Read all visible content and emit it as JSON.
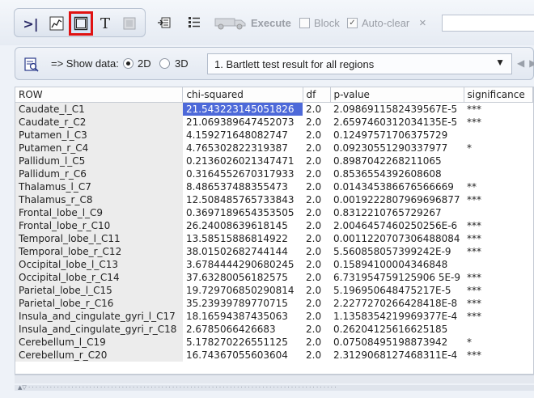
{
  "toolbar": {
    "tools": [
      {
        "name": "script-mode-icon",
        "glyph": "Ɜ"
      },
      {
        "name": "chart-mode-icon",
        "glyph": "📈"
      },
      {
        "name": "table-mode-icon",
        "glyph": ""
      },
      {
        "name": "text-mode-icon",
        "glyph": "T"
      },
      {
        "name": "image-mode-icon",
        "glyph": ""
      }
    ],
    "execute_label": "Execute",
    "block_label": "Block",
    "autoclear_label": "Auto-clear",
    "autoclear_checked": true,
    "close_glyph": "×",
    "search_value": ""
  },
  "options": {
    "show_data_label": "=> Show data:",
    "radio_2d": "2D",
    "radio_3d": "3D",
    "selected_mode": "2D",
    "result_selection": "1. Bartlett test result for all regions"
  },
  "table": {
    "columns": [
      "ROW",
      "chi-squared",
      "df",
      "p-value",
      "significance"
    ],
    "rows": [
      [
        "Caudate_l_C1",
        "21.543223145051826",
        "2.0",
        "2.0986911582439567E-5",
        "***"
      ],
      [
        "Caudate_r_C2",
        "21.069389647452073",
        "2.0",
        "2.6597460312034135E-5",
        "***"
      ],
      [
        "Putamen_l_C3",
        "4.159271648082747",
        "2.0",
        "0.12497571706375729",
        ""
      ],
      [
        "Putamen_r_C4",
        "4.765302822319387",
        "2.0",
        "0.09230551290337977",
        "*"
      ],
      [
        "Pallidum_l_C5",
        "0.2136026021347471",
        "2.0",
        "0.8987042268211065",
        ""
      ],
      [
        "Pallidum_r_C6",
        "0.3164552670317933",
        "2.0",
        "0.8536554392608608",
        ""
      ],
      [
        "Thalamus_l_C7",
        "8.486537488355473",
        "2.0",
        "0.014345386676566669",
        "**"
      ],
      [
        "Thalamus_r_C8",
        "12.508485765733843",
        "2.0",
        "0.0019222807969696877",
        "***"
      ],
      [
        "Frontal_lobe_l_C9",
        "0.3697189654353505",
        "2.0",
        "0.8312210765729267",
        ""
      ],
      [
        "Frontal_lobe_r_C10",
        "26.24008639618145",
        "2.0",
        "2.0046457460250256E-6",
        "***"
      ],
      [
        "Temporal_lobe_l_C11",
        "13.58515886814922",
        "2.0",
        "0.0011220707306488084",
        "***"
      ],
      [
        "Temporal_lobe_r_C12",
        "38.01502682744144",
        "2.0",
        "5.560858057399242E-9",
        "***"
      ],
      [
        "Occipital_lobe_l_C13",
        "3.6784444290680245",
        "2.0",
        "0.15894100004346848",
        ""
      ],
      [
        "Occipital_lobe_r_C14",
        "37.63280056182575",
        "2.0",
        "6.731954759125906 5E-9",
        "***"
      ],
      [
        "Parietal_lobe_l_C15",
        "19.729706850290814",
        "2.0",
        "5.196950648475217E-5",
        "***"
      ],
      [
        "Parietal_lobe_r_C16",
        "35.23939789770715",
        "2.0",
        "2.2277270266428418E-8",
        "***"
      ],
      [
        "Insula_and_cingulate_gyri_l_C17",
        "18.16594387435063",
        "2.0",
        "1.1358354219969377E-4",
        "***"
      ],
      [
        "Insula_and_cingulate_gyri_r_C18",
        "2.6785066426683",
        "2.0",
        "0.26204125616625185",
        ""
      ],
      [
        "Cerebellum_l_C19",
        "5.178270226551125",
        "2.0",
        "0.07508495198873942",
        "*"
      ],
      [
        "Cerebellum_r_C20",
        "16.74367055603604",
        "2.0",
        "2.3129068127468311E-4",
        "***"
      ]
    ],
    "highlighted_cell": {
      "row": 0,
      "col": 1
    }
  }
}
